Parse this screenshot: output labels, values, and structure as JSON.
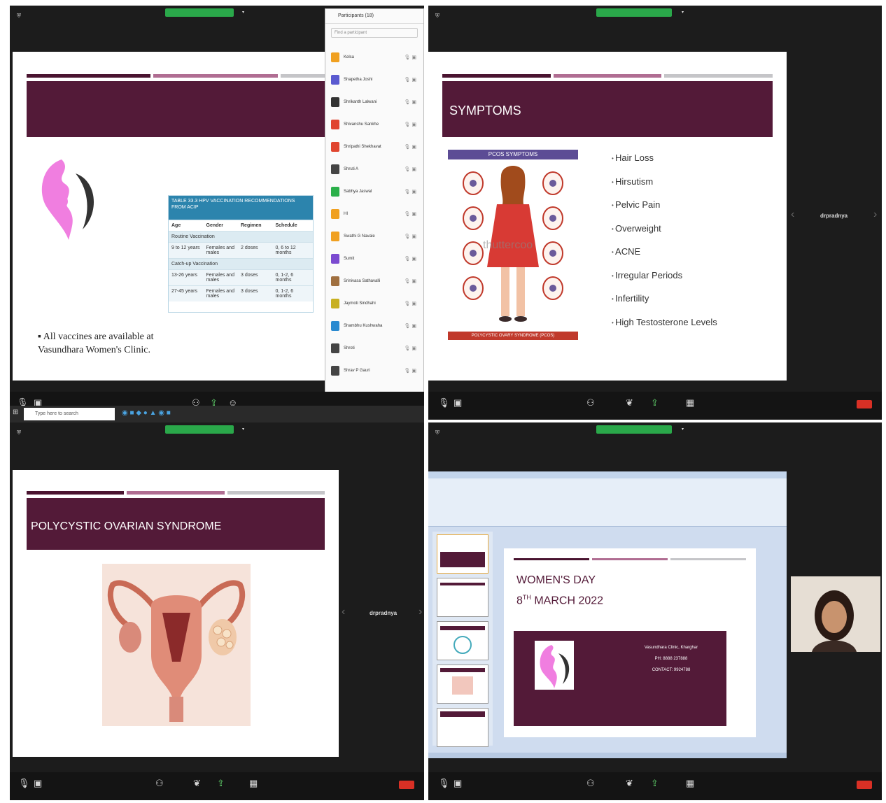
{
  "quadrant_1": {
    "slide_bullet": "All vaccines are available at Vasundhara Women's Clinic.",
    "table": {
      "title": "TABLE 33.3 HPV VACCINATION RECOMMENDATIONS FROM ACIP",
      "headers": [
        "Age",
        "Gender",
        "Regimen",
        "Schedule"
      ],
      "section_routine": "Routine Vaccination",
      "row_routine": [
        "9 to 12 years",
        "Females and males",
        "2 doses",
        "0, 6 to 12 months"
      ],
      "section_catchup": "Catch-up Vaccination",
      "rows_catchup": [
        [
          "13-26 years",
          "Females and males",
          "3 doses",
          "0, 1-2, 6 months"
        ],
        [
          "27-45 years",
          "Females and males",
          "3 doses",
          "0, 1-2, 6 months"
        ]
      ]
    },
    "participants_title": "Participants (18)",
    "participants_search": "Find a participant",
    "participants": [
      "Kelsa",
      "Shapetha Joshi",
      "Shrikanth Lalwani",
      "Shivanshu Sankhe",
      "Shripathi Shekhavat",
      "Shruti A",
      "Sabhya Jaswal",
      "HI",
      "Swathi G Navale",
      "Sumit",
      "Srinivasa Sathavalli",
      "Jaymoti Sindhahi",
      "Shambhu Kushwaha",
      "Shroti",
      "Shrav P Gauri"
    ],
    "taskbar_search": "Type here to search"
  },
  "quadrant_2": {
    "slide_title": "SYMPTOMS",
    "infographic_title": "PCOS SYMPTOMS",
    "infographic_footer": "POLYCYSTIC OVARY SYNDROME (PCOS)",
    "watermark": "thuttercoo",
    "symptoms": [
      "Hair Loss",
      "Hirsutism",
      "Pelvic Pain",
      "Overweight",
      "ACNE",
      "Irregular Periods",
      "Infertility",
      "High Testosterone Levels"
    ],
    "side_participant": "drpradnya"
  },
  "quadrant_3": {
    "slide_title": "POLYCYSTIC OVARIAN SYNDROME",
    "side_participant": "drpradnya"
  },
  "quadrant_4": {
    "slide_title_line1": "WOMEN'S DAY",
    "slide_title_line2_main": "8",
    "slide_title_line2_sup": "TH",
    "slide_title_line2_rest": " MARCH 2022",
    "clinic_lines": [
      "Vasundhara Clinic, Kharghar",
      "PH: 8888 237888",
      "CONTACT: 9924788"
    ]
  },
  "colors": {
    "slide_maroon": "#531a38",
    "logo_pink": "#f07ee0",
    "share_green": "#2aa84a",
    "end_red": "#d93025"
  }
}
